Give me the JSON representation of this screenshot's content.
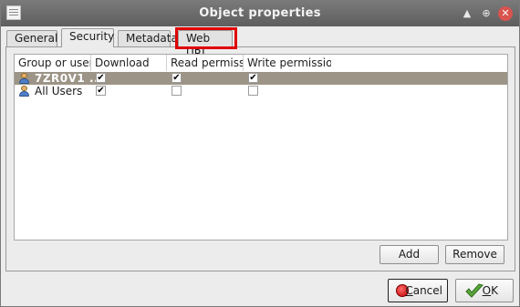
{
  "window": {
    "title": "Object properties",
    "controls": {
      "shade_icon": "shade-icon",
      "maximize_icon": "maximize-icon",
      "close_icon": "close-icon",
      "shade_glyph": "▲",
      "maximize_glyph": "⊕",
      "close_glyph": "✕"
    }
  },
  "tabs": [
    {
      "label": "General",
      "active": false
    },
    {
      "label": "Security",
      "active": true
    },
    {
      "label": "Metadata",
      "active": false
    },
    {
      "label": "Web URL",
      "active": false,
      "highlighted": true
    }
  ],
  "permissions_table": {
    "columns": [
      "Group or user n",
      "Download",
      "Read permission",
      "Write permissions"
    ],
    "rows": [
      {
        "name": "7ZR0V1 ...",
        "download": true,
        "read": true,
        "write": true,
        "selected": true
      },
      {
        "name": "All Users",
        "download": true,
        "read": false,
        "write": false,
        "selected": false
      }
    ]
  },
  "buttons": {
    "add": "Add",
    "remove": "Remove",
    "cancel_mnemonic": "C",
    "cancel_rest": "ancel",
    "ok_mnemonic": "O",
    "ok_rest": "K"
  },
  "colors": {
    "titlebar": "#6b6b6b",
    "selected_row": "#9c9486",
    "highlight": "#e00000",
    "close": "#d9534f"
  }
}
